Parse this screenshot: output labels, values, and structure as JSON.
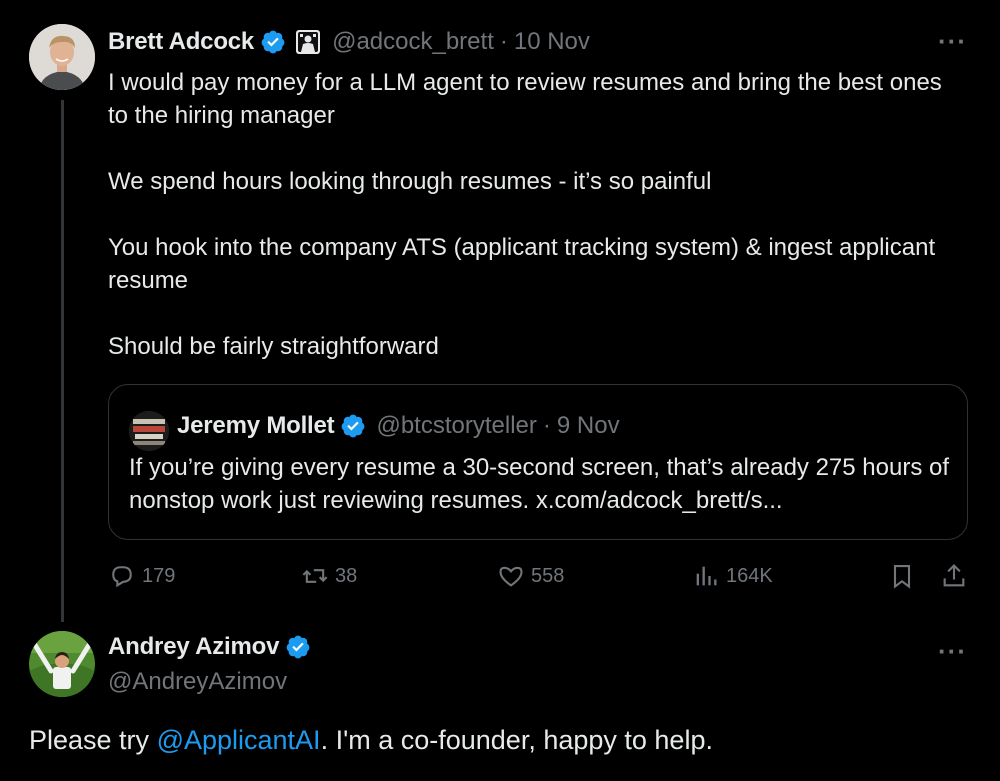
{
  "tweet": {
    "author_name": "Brett Adcock",
    "author_handle": "@adcock_brett",
    "date": "10 Nov",
    "separator": "·",
    "more": "···",
    "paragraphs": [
      "I would pay money for a LLM agent to review resumes and bring the best ones to the hiring manager",
      "We spend hours looking through resumes - it’s so painful",
      "You hook into the company ATS (applicant tracking system) & ingest applicant resume",
      "Should be fairly straightforward"
    ],
    "quote": {
      "author_name": "Jeremy Mollet",
      "author_handle": "@btcstoryteller",
      "date": "9 Nov",
      "text": "If you’re giving every resume a 30-second screen, that’s already 275 hours of nonstop work just reviewing resumes. x.com/adcock_brett/s..."
    },
    "actions": {
      "replies": "179",
      "reposts": "38",
      "likes": "558",
      "views": "164K"
    }
  },
  "reply": {
    "author_name": "Andrey Azimov",
    "author_handle": "@AndreyAzimov",
    "more": "···",
    "text_before": "Please try ",
    "mention": "@ApplicantAI",
    "text_after": ". I'm a co-founder, happy to help."
  },
  "colors": {
    "background": "#000000",
    "text": "#e7e9ea",
    "secondary": "#71767b",
    "accent": "#1d9bf0",
    "border": "#2f3336"
  }
}
